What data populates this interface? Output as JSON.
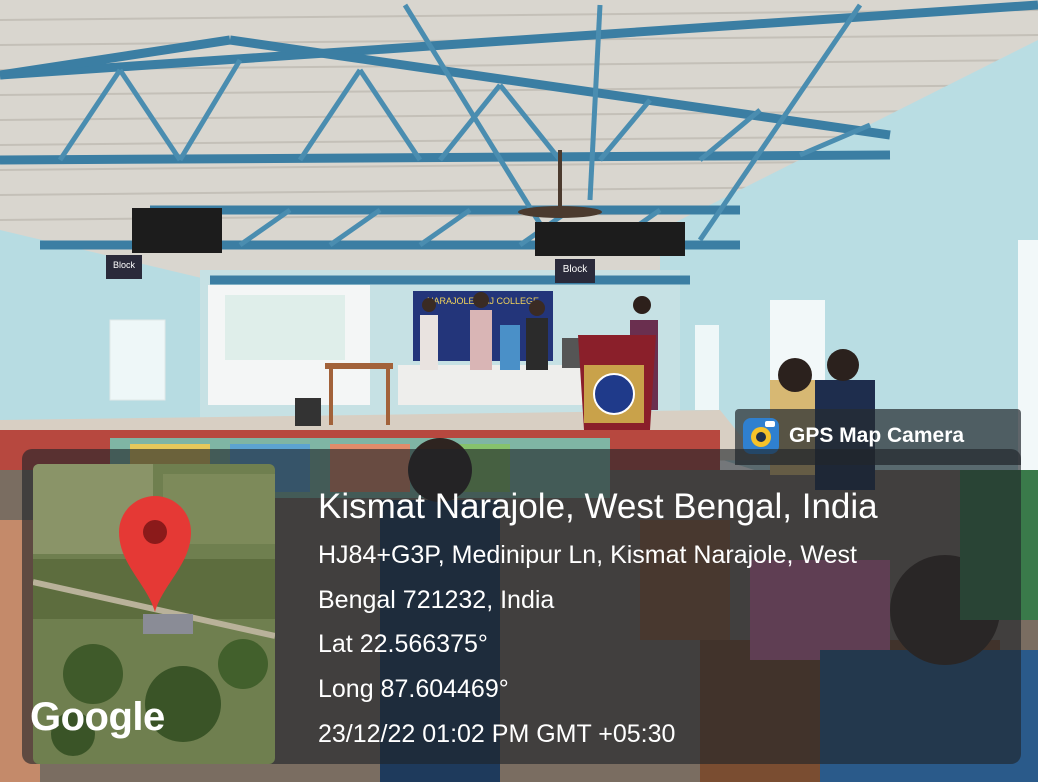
{
  "badge": {
    "app_name": "GPS Map Camera",
    "icon": "gps-map-camera-icon"
  },
  "stage": {
    "sign_left": "Block",
    "sign_right": "Block",
    "banner_text": "NARAJOLE RAJ COLLEGE"
  },
  "location": {
    "title": "Kismat Narajole, West Bengal, India",
    "address_line1": "HJ84+G3P, Medinipur Ln, Kismat Narajole, West",
    "address_line2": "Bengal 721232, India",
    "lat": "Lat 22.566375°",
    "long": "Long 87.604469°",
    "datetime": "23/12/22 01:02 PM GMT +05:30"
  },
  "map": {
    "brand": "Google",
    "pin": "map-pin-icon"
  },
  "colors": {
    "truss": "#3b7ea3",
    "wall": "#bfe0e6",
    "podium": "#8a1f2a",
    "pin": "#e53935"
  }
}
